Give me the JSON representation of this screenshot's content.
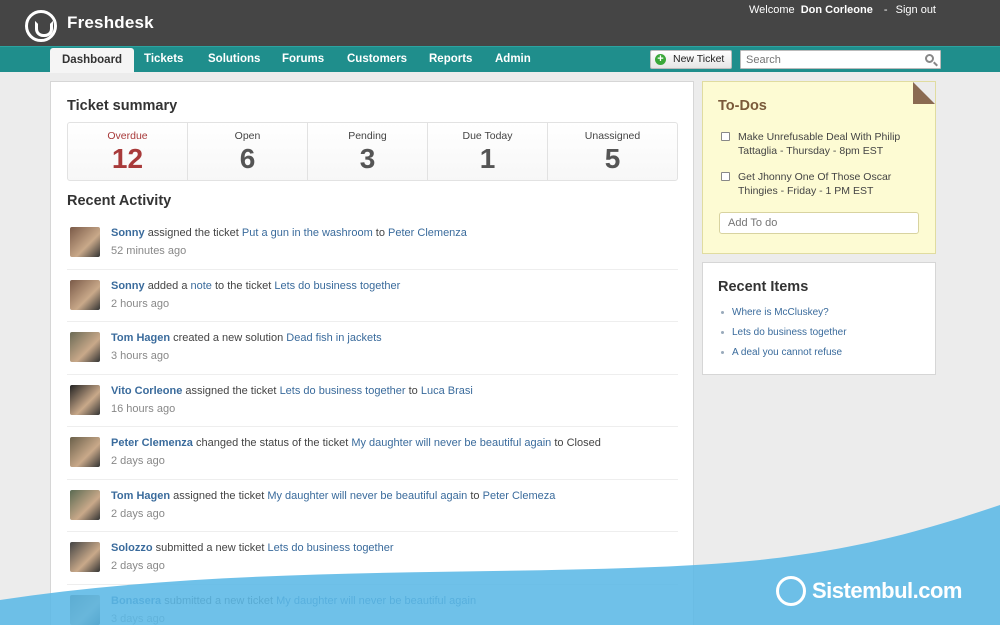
{
  "header": {
    "brand": "Freshdesk",
    "welcome": "Welcome",
    "username": "Don Corleone",
    "separator": "-",
    "signout": "Sign out"
  },
  "nav": {
    "tabs": [
      {
        "label": "Dashboard",
        "active": true
      },
      {
        "label": "Tickets"
      },
      {
        "label": "Solutions"
      },
      {
        "label": "Forums"
      },
      {
        "label": "Customers"
      },
      {
        "label": "Reports"
      },
      {
        "label": "Admin"
      }
    ],
    "new_ticket": "New Ticket",
    "search_placeholder": "Search"
  },
  "summary": {
    "title": "Ticket summary",
    "items": [
      {
        "label": "Overdue",
        "value": "12"
      },
      {
        "label": "Open",
        "value": "6"
      },
      {
        "label": "Pending",
        "value": "3"
      },
      {
        "label": "Due Today",
        "value": "1"
      },
      {
        "label": "Unassigned",
        "value": "5"
      }
    ]
  },
  "activity": {
    "title": "Recent Activity",
    "items": [
      {
        "user": "Sonny",
        "action": "assigned the ticket",
        "link": "Put a gun in the washroom",
        "mid": "to",
        "target": "Peter Clemenza",
        "time": "52 minutes ago"
      },
      {
        "user": "Sonny",
        "action": "added a",
        "link": "note",
        "mid": "to the ticket",
        "target": "Lets do business together",
        "time": "2 hours ago"
      },
      {
        "user": "Tom Hagen",
        "action": "created a new solution",
        "link": "Dead fish in jackets",
        "mid": "",
        "target": "",
        "time": "3 hours ago"
      },
      {
        "user": "Vito Corleone",
        "action": "assigned the ticket",
        "link": "Lets do business together",
        "mid": "to",
        "target": "Luca Brasi",
        "time": "16 hours ago"
      },
      {
        "user": "Peter Clemenza",
        "action": "changed the status of the ticket",
        "link": "My daughter will never be beautiful again",
        "mid": "to Closed",
        "target": "",
        "time": "2 days ago"
      },
      {
        "user": "Tom Hagen",
        "action": "assigned the ticket",
        "link": "My daughter will never be beautiful again",
        "mid": "to",
        "target": "Peter Clemeza",
        "time": "2 days ago"
      },
      {
        "user": "Solozzo",
        "action": "submitted a new ticket",
        "link": "Lets do business together",
        "mid": "",
        "target": "",
        "time": "2 days ago"
      },
      {
        "user": "Bonasera",
        "action": "submitted a new ticket",
        "link": "My daughter will never be beautiful again",
        "mid": "",
        "target": "",
        "time": "3 days ago"
      }
    ]
  },
  "todos": {
    "title": "To-Dos",
    "items": [
      {
        "text": "Make Unrefusable Deal With Philip Tattaglia - Thursday - 8pm EST"
      },
      {
        "text": "Get Jhonny One Of Those Oscar Thingies - Friday - 1 PM EST"
      }
    ],
    "add_placeholder": "Add To do"
  },
  "recent": {
    "title": "Recent Items",
    "items": [
      {
        "label": "Where is McCluskey?"
      },
      {
        "label": "Lets do business together"
      },
      {
        "label": "A deal you cannot refuse"
      }
    ]
  },
  "watermark": "Sistembul.com",
  "colors": {
    "header_bg": "#454545",
    "nav_bg": "#1f8e8c",
    "link": "#3a6b9c",
    "overdue": "#a83a3a",
    "todo_bg": "#fdfbd3",
    "wave": "#5bb8e6"
  }
}
